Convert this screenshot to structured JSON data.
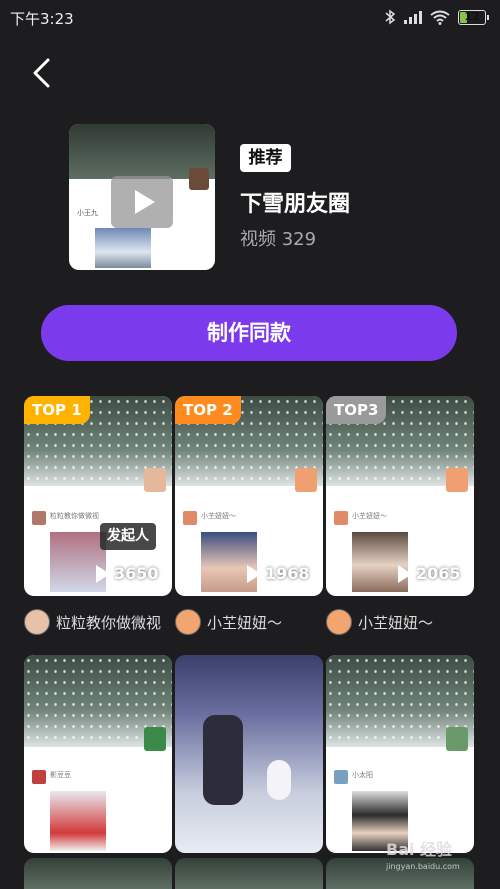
{
  "status_bar": {
    "time": "下午3:23",
    "battery": "12",
    "icons": [
      "bluetooth-icon",
      "signal-icon",
      "wifi-icon",
      "battery-icon"
    ]
  },
  "header": {
    "badge": "推荐",
    "title": "下雪朋友圈",
    "video_count": "视频 329",
    "cover_caption": "小王九"
  },
  "make_button": "制作同款",
  "accent_color": "#7b3bec",
  "top_cards": [
    {
      "rank": "TOP 1",
      "rank_color": "#ffb300",
      "plays": "3650",
      "mini_name": "粒粒教你做微视",
      "tag": "发起人",
      "author": "粒粒教你做微视"
    },
    {
      "rank": "TOP 2",
      "rank_color": "#ff8a1e",
      "plays": "1968",
      "mini_name": "小芏妞妞～",
      "author": "小芏妞妞～"
    },
    {
      "rank": "TOP3",
      "rank_color": "#9a9a9a",
      "plays": "2065",
      "mini_name": "小芏妞妞～",
      "author": "小芏妞妞～"
    }
  ],
  "more_cards": [
    {
      "mini_name": "影豆豆"
    },
    {
      "mini_name": ""
    },
    {
      "mini_name": "小太阳"
    }
  ],
  "watermark": {
    "brand": "Bai 经验",
    "url": "jingyan.baidu.com"
  }
}
